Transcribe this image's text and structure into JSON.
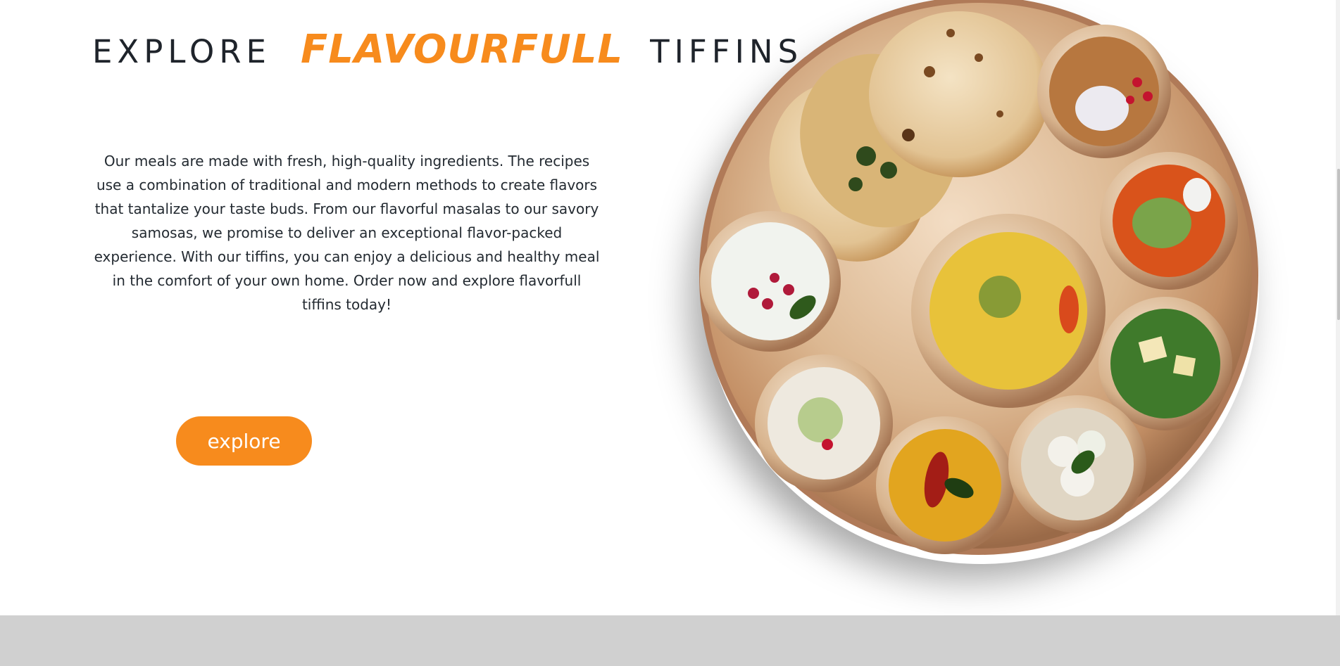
{
  "hero": {
    "title_word_1": "EXPLORE",
    "title_word_2": "FLAVOURFULL",
    "title_word_3": "TIFFINS",
    "description": "Our meals are made with fresh, high-quality ingredients. The recipes use a combination of traditional and modern methods to create flavors that tantalize your taste buds. From our flavorful masalas to our savory samosas, we promise to deliver an exceptional flavor-packed experience. With our tiffins, you can enjoy a delicious and healthy meal in the comfort of your own home. Order now and explore flavorfull tiffins today!",
    "button_label": "explore"
  },
  "colors": {
    "accent": "#f78b1d",
    "text": "#1f242b",
    "footer_band": "#d0d0d0"
  }
}
